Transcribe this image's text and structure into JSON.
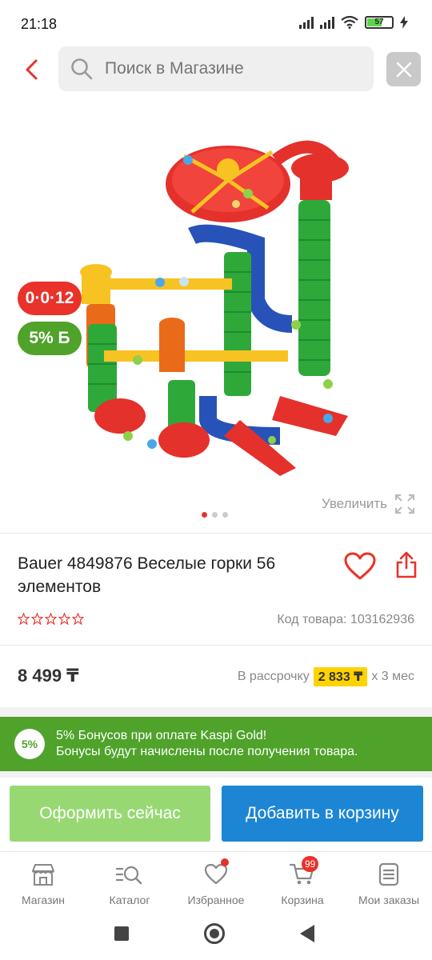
{
  "status": {
    "time": "21:18",
    "battery": "57"
  },
  "search": {
    "placeholder": "Поиск в Магазине"
  },
  "badges": {
    "credit": "0·0·12",
    "bonus": "5% Б"
  },
  "gallery": {
    "zoom_label": "Увеличить",
    "page_count": 3,
    "active_page": 1
  },
  "product": {
    "title": "Bauer 4849876 Веселые горки 56 элементов",
    "rating": 0,
    "rating_max": 5,
    "code": "Код товара: 103162936",
    "price": "8 499 ₸",
    "installment_prefix": "В рассрочку",
    "installment_amount": "2 833 ₸",
    "installment_suffix": "x 3 мес"
  },
  "bonus_banner": {
    "circle": "5%",
    "line1": "5% Бонусов при оплате Kaspi Gold!",
    "line2": "Бонусы будут начислены после получения товара."
  },
  "actions": {
    "buy_now": "Оформить сейчас",
    "add_to_cart": "Добавить в корзину"
  },
  "tabs": [
    {
      "label": "Магазин",
      "icon": "shop-icon"
    },
    {
      "label": "Каталог",
      "icon": "catalog-search-icon"
    },
    {
      "label": "Избранное",
      "icon": "heart-icon"
    },
    {
      "label": "Корзина",
      "icon": "cart-icon",
      "badge": "99"
    },
    {
      "label": "Мои заказы",
      "icon": "orders-icon"
    }
  ],
  "colors": {
    "accent_red": "#e8322a",
    "bonus_green": "#4fa22a",
    "buy_green": "#97d873",
    "cart_blue": "#1d86d4",
    "installment_yellow": "#ffd300"
  }
}
